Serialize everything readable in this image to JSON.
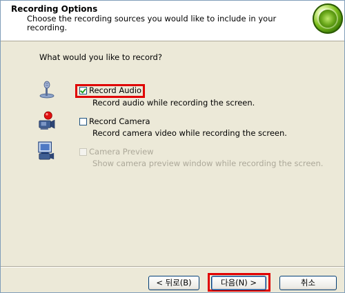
{
  "header": {
    "title": "Recording Options",
    "description": "Choose the recording sources you would like to include in your recording."
  },
  "question": "What would you like to record?",
  "options": [
    {
      "label": "Record Audio",
      "description": "Record audio while recording the screen.",
      "checked": true,
      "enabled": true,
      "icon": "microphone-icon"
    },
    {
      "label": "Record Camera",
      "description": "Record camera video while recording the screen.",
      "checked": false,
      "enabled": true,
      "icon": "camera-icon"
    },
    {
      "label": "Camera Preview",
      "description": "Show camera preview window while recording the screen.",
      "checked": false,
      "enabled": false,
      "icon": "camera-preview-icon"
    }
  ],
  "buttons": {
    "back": "< 뒤로(B)",
    "next": "다음(N) >",
    "cancel": "취소"
  },
  "colors": {
    "highlight": "#e00000",
    "dialog_bg": "#ece9d8"
  }
}
